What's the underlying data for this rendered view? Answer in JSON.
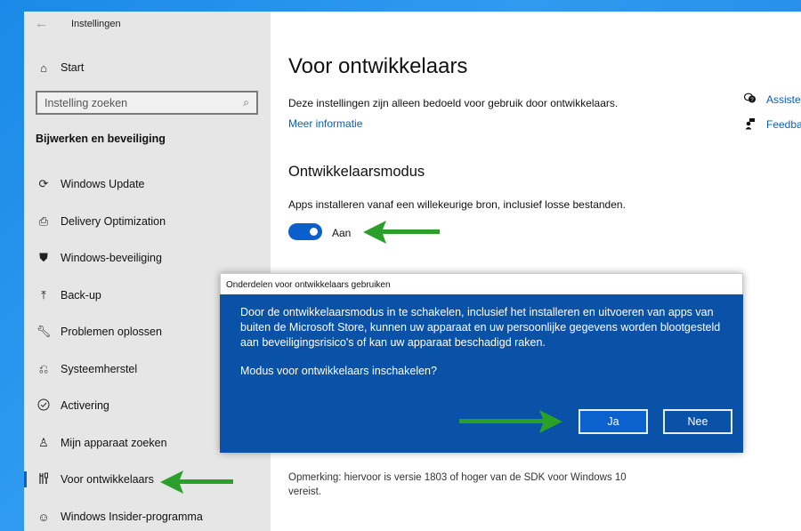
{
  "window": {
    "app_title": "Instellingen",
    "back_icon": "←"
  },
  "sidebar": {
    "home": {
      "label": "Start",
      "icon": "home-icon",
      "glyph": "⌂"
    },
    "search": {
      "placeholder": "Instelling zoeken",
      "value": "",
      "icon": "search-icon",
      "glyph": "⚲"
    },
    "section_title": "Bijwerken en beveiliging",
    "items": [
      {
        "label": "Windows Update",
        "icon": "sync-icon",
        "glyph": "⟳",
        "selected": false
      },
      {
        "label": "Delivery Optimization",
        "icon": "delivery-icon",
        "glyph": "⎙",
        "selected": false
      },
      {
        "label": "Windows-beveiliging",
        "icon": "shield-icon",
        "glyph": "⛊",
        "selected": false
      },
      {
        "label": "Back-up",
        "icon": "upload-icon",
        "glyph": "⤒",
        "selected": false
      },
      {
        "label": "Problemen oplossen",
        "icon": "wrench-icon",
        "glyph": "🔧",
        "selected": false
      },
      {
        "label": "Systeemherstel",
        "icon": "restore-icon",
        "glyph": "⎌",
        "selected": false
      },
      {
        "label": "Activering",
        "icon": "check-circle-icon",
        "glyph": "✓",
        "selected": false
      },
      {
        "label": "Mijn apparaat zoeken",
        "icon": "find-device-icon",
        "glyph": "♙",
        "selected": false
      },
      {
        "label": "Voor ontwikkelaars",
        "icon": "developer-tools-icon",
        "glyph": "⫿",
        "selected": true
      },
      {
        "label": "Windows Insider-programma",
        "icon": "insider-icon",
        "glyph": "☺",
        "selected": false
      }
    ]
  },
  "main": {
    "title": "Voor ontwikkelaars",
    "description": "Deze instellingen zijn alleen bedoeld voor gebruik door ontwikkelaars.",
    "more_info_link": "Meer informatie",
    "section_title": "Ontwikkelaarsmodus",
    "option_description": "Apps installeren vanaf een willekeurige bron, inclusief losse bestanden.",
    "toggle": {
      "state": "on",
      "label": "Aan"
    },
    "note": "Opmerking: hiervoor is versie 1803 of hoger van de SDK voor Windows 10 vereist.",
    "side_links": [
      {
        "label": "Assistentie",
        "icon": "help-chat-icon",
        "glyph": "💬"
      },
      {
        "label": "Feedback",
        "icon": "feedback-icon",
        "glyph": "👤"
      }
    ]
  },
  "dialog": {
    "title": "Onderdelen voor ontwikkelaars gebruiken",
    "message": "Door de ontwikkelaarsmodus in te schakelen, inclusief het installeren en uitvoeren van apps van buiten de Microsoft Store, kunnen uw apparaat en uw persoonlijke gegevens worden blootgesteld aan beveiligingsrisico's of kan uw apparaat beschadigd raken.",
    "question": "Modus voor ontwikkelaars inschakelen?",
    "yes_label": "Ja",
    "no_label": "Nee"
  },
  "colors": {
    "accent": "#0a5fcc",
    "dialog_bg": "#0a52a8",
    "annotation_arrow": "#2aa02a"
  }
}
